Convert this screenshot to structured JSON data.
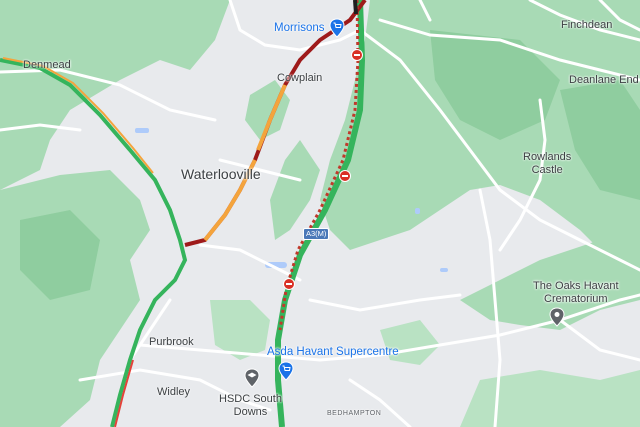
{
  "map": {
    "places": {
      "denmead": "Denmead",
      "cowplain": "Cowplain",
      "waterlooville": "Waterlooville",
      "purbrook": "Purbrook",
      "widley": "Widley",
      "bedhampton": "BEDHAMPTON",
      "finchdean": "Finchdean",
      "deanlane_end": "Deanlane End",
      "rowlands_castle": "Rowlands\nCastle"
    },
    "pois": {
      "morrisons": "Morrisons",
      "asda": "Asda Havant Supercentre",
      "hsdc": "HSDC South\nDowns",
      "crematorium": "The Oaks Havant\nCrematorium"
    },
    "road_shield": "A3(M)",
    "colors": {
      "traffic_green": "#35b45c",
      "traffic_orange": "#f4a43c",
      "traffic_red": "#e3423a",
      "traffic_darkred": "#9e1a1a",
      "closure": "#c0392b",
      "woodland": "#a8dab5",
      "urban": "#e8eaed"
    }
  }
}
